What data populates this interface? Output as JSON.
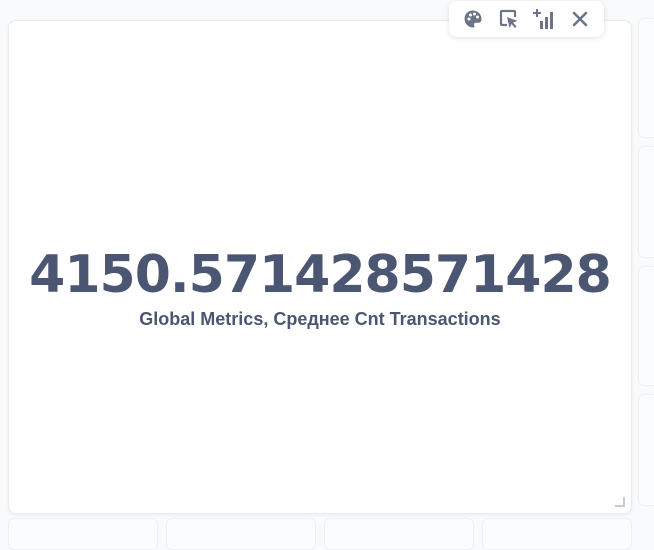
{
  "scalar": {
    "value": "4150.571428571428",
    "title": "Global Metrics, Среднее Cnt Transactions"
  },
  "toolbar": {
    "icons": [
      "palette-icon",
      "click-behavior-icon",
      "add-series-icon",
      "close-icon"
    ]
  },
  "colors": {
    "text": "#4b5672",
    "icon": "#6b7489",
    "card_bg": "#ffffff",
    "page_bg": "#f9fafb"
  }
}
